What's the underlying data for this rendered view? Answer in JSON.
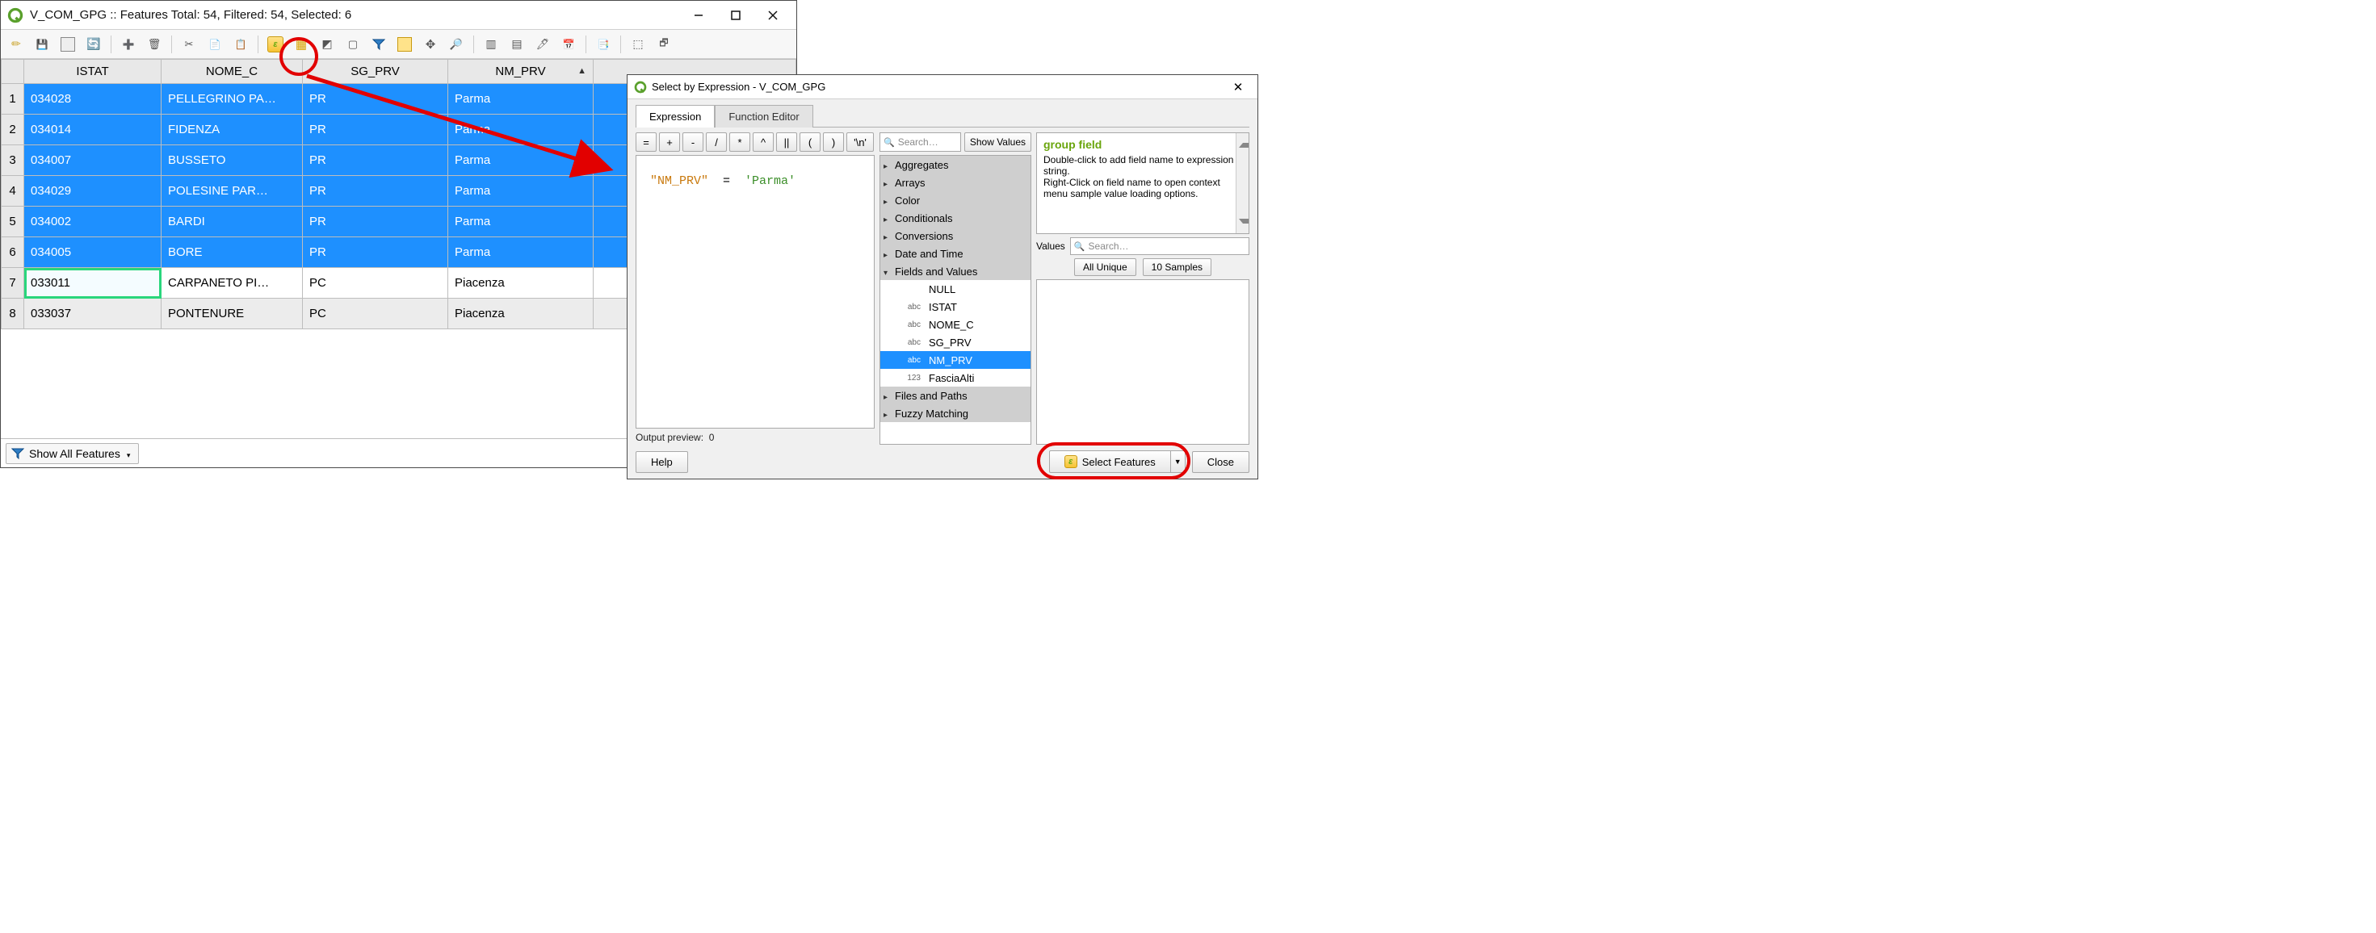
{
  "attr_window": {
    "title": "V_COM_GPG :: Features Total: 54, Filtered: 54, Selected: 6",
    "columns": [
      "ISTAT",
      "NOME_C",
      "SG_PRV",
      "NM_PRV"
    ],
    "sort_column": "NM_PRV",
    "rows": [
      {
        "n": "1",
        "istat": "034028",
        "nome": "PELLEGRINO PA…",
        "sg": "PR",
        "nm": "Parma",
        "sel": true
      },
      {
        "n": "2",
        "istat": "034014",
        "nome": "FIDENZA",
        "sg": "PR",
        "nm": "Parma",
        "sel": true
      },
      {
        "n": "3",
        "istat": "034007",
        "nome": "BUSSETO",
        "sg": "PR",
        "nm": "Parma",
        "sel": true
      },
      {
        "n": "4",
        "istat": "034029",
        "nome": "POLESINE PAR…",
        "sg": "PR",
        "nm": "Parma",
        "sel": true
      },
      {
        "n": "5",
        "istat": "034002",
        "nome": "BARDI",
        "sg": "PR",
        "nm": "Parma",
        "sel": true
      },
      {
        "n": "6",
        "istat": "034005",
        "nome": "BORE",
        "sg": "PR",
        "nm": "Parma",
        "sel": true
      },
      {
        "n": "7",
        "istat": "033011",
        "nome": "CARPANETO PI…",
        "sg": "PC",
        "nm": "Piacenza",
        "sel": false,
        "current": true
      },
      {
        "n": "8",
        "istat": "033037",
        "nome": "PONTENURE",
        "sg": "PC",
        "nm": "Piacenza",
        "sel": false,
        "alt": true
      }
    ],
    "show_all_label": "Show All Features"
  },
  "dialog": {
    "title": "Select by Expression - V_COM_GPG",
    "tabs": {
      "expression": "Expression",
      "function_editor": "Function Editor"
    },
    "ops": [
      "=",
      "+",
      "-",
      "/",
      "*",
      "^",
      "||",
      "(",
      ")",
      "'\\n'"
    ],
    "expression_field": "\"NM_PRV\"",
    "expression_op": "  =  ",
    "expression_value": "'Parma'",
    "search_placeholder": "Search…",
    "show_values": "Show Values",
    "tree_groups_top": [
      "Aggregates",
      "Arrays",
      "Color",
      "Conditionals",
      "Conversions",
      "Date and Time"
    ],
    "fields_group": "Fields and Values",
    "fields": [
      {
        "type": "",
        "name": "NULL"
      },
      {
        "type": "abc",
        "name": "ISTAT"
      },
      {
        "type": "abc",
        "name": "NOME_C"
      },
      {
        "type": "abc",
        "name": "SG_PRV"
      },
      {
        "type": "abc",
        "name": "NM_PRV",
        "selected": true
      },
      {
        "type": "123",
        "name": "FasciaAlti"
      }
    ],
    "tree_groups_bottom": [
      "Files and Paths",
      "Fuzzy Matching"
    ],
    "help": {
      "title": "group field",
      "body": "Double-click to add field name to expression string.\nRight-Click on field name to open context menu sample value loading options."
    },
    "values_label": "Values",
    "values_search_placeholder": "Search…",
    "all_unique": "All Unique",
    "ten_samples": "10 Samples",
    "output_preview_label": "Output preview:",
    "output_preview_value": "0",
    "help_btn": "Help",
    "select_features": "Select Features",
    "close_btn": "Close"
  }
}
